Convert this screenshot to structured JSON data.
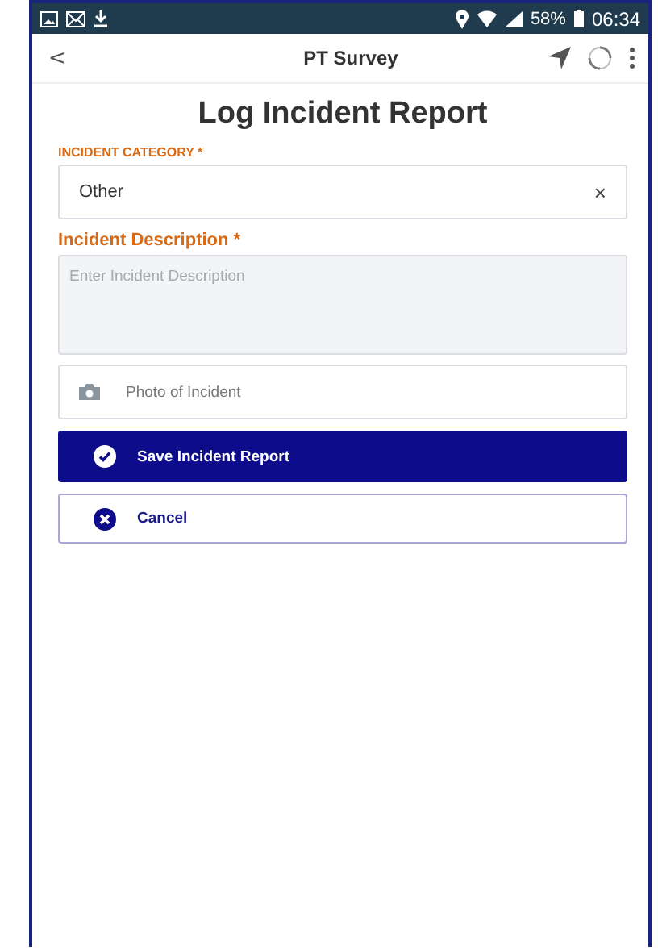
{
  "status_bar": {
    "battery": "58%",
    "time": "06:34"
  },
  "app_bar": {
    "back": "<",
    "title": "PT Survey"
  },
  "page_title": "Log Incident Report",
  "category": {
    "label": "INCIDENT CATEGORY *",
    "value": "Other",
    "clear": "×"
  },
  "description": {
    "label": "Incident Description *",
    "placeholder": "Enter Incident Description"
  },
  "photo": {
    "label": "Photo of Incident"
  },
  "buttons": [
    {
      "kind": "primary",
      "label": "Save Incident Report"
    },
    {
      "kind": "secondary",
      "label": "Cancel"
    }
  ]
}
